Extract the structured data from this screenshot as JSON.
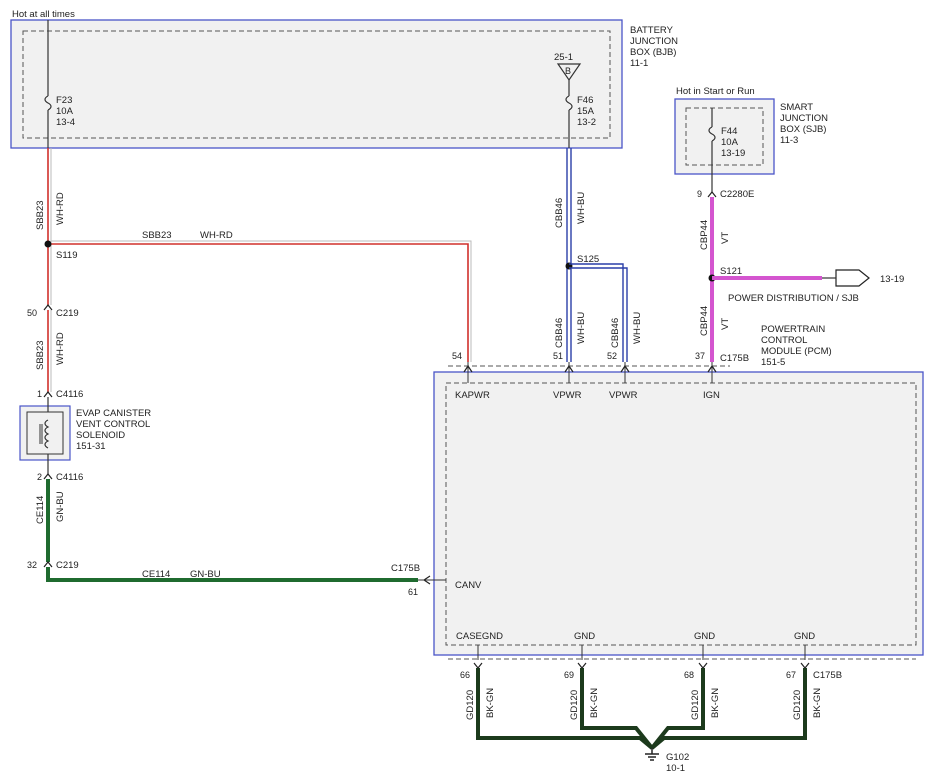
{
  "title": "Hot at all times",
  "bjb": {
    "title_lines": [
      "BATTERY",
      "JUNCTION",
      "BOX (BJB)",
      "11-1"
    ]
  },
  "sjb": {
    "title_lines": [
      "SMART",
      "JUNCTION",
      "BOX (SJB)",
      "11-3"
    ],
    "hot_label": "Hot in Start or Run"
  },
  "fuses": {
    "f23": [
      "F23",
      "10A",
      "13-4"
    ],
    "f46": [
      "F46",
      "15A",
      "13-2"
    ],
    "f44": [
      "F44",
      "10A",
      "13-19"
    ]
  },
  "bus": {
    "label": "25-1",
    "letter": "B"
  },
  "wires": {
    "sbb23": {
      "circuit": "SBB23",
      "color": "WH-RD"
    },
    "cbb46": {
      "circuit": "CBB46",
      "color": "WH-BU"
    },
    "cbp44": {
      "circuit": "CBP44",
      "color": "VT"
    },
    "ce114": {
      "circuit": "CE114",
      "color": "GN-BU"
    },
    "gd120": {
      "circuit": "GD120",
      "color": "BK-GN"
    }
  },
  "splices": {
    "s119": "S119",
    "s125": "S125",
    "s121": "S121"
  },
  "connectors": {
    "c219": "C219",
    "c4116": "C4116",
    "c175b": "C175B",
    "c2280e": "C2280E"
  },
  "pins": {
    "c219_top": "50",
    "c4116_top": "1",
    "c4116_bot": "2",
    "c219_bot": "32",
    "kapwr": "54",
    "vpwr1": "51",
    "vpwr2": "52",
    "ign": "37",
    "sjb_out": "9",
    "canv": "61",
    "gnd1": "66",
    "gnd2": "69",
    "gnd3": "68",
    "gnd4": "67"
  },
  "solenoid": {
    "title_lines": [
      "EVAP CANISTER",
      "VENT CONTROL",
      "SOLENOID",
      "151-31"
    ]
  },
  "pcm": {
    "title_lines": [
      "POWERTRAIN",
      "CONTROL",
      "MODULE (PCM)",
      "151-5"
    ],
    "pins": {
      "kapwr": "KAPWR",
      "vpwr": "VPWR",
      "ign": "IGN",
      "canv": "CANV",
      "casegnd": "CASEGND",
      "gnd": "GND"
    }
  },
  "power_dist": {
    "label": "POWER DISTRIBUTION / SJB",
    "ref": "13-19"
  },
  "ground": {
    "label": "G102",
    "ref": "10-1"
  },
  "colors": {
    "wh_rd": "#d0302c",
    "wh_bu": "#2a3fa8",
    "vt": "#d455cf",
    "gn_bu": "#1f6b2f",
    "bk_gn": "#1c3a1c",
    "box_border": "#4a55c8",
    "module_fill": "#f1f1f1"
  }
}
